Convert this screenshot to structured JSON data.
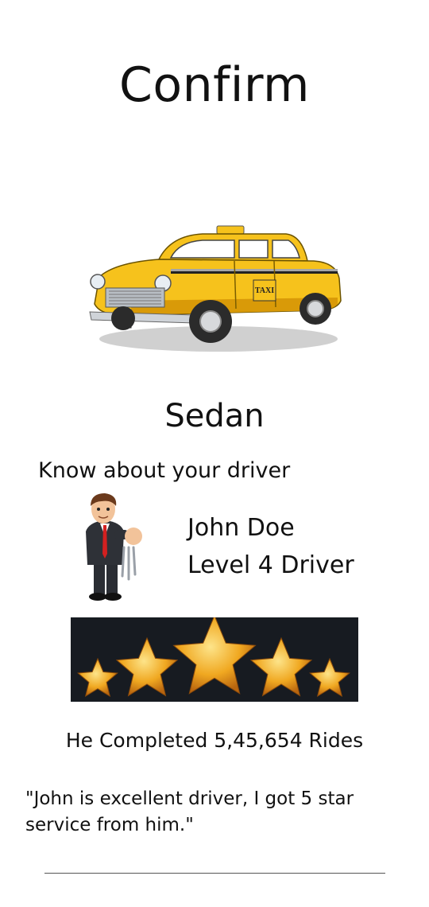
{
  "header": {
    "title": "Confirm"
  },
  "vehicle": {
    "image_icon": "taxi-car-icon",
    "type_label": "Sedan",
    "sign_text": "TAXI",
    "colors": {
      "body": "#f6c21c",
      "body_shade": "#d99a08",
      "tire": "#2b2b2b",
      "chrome": "#cfd3d8"
    }
  },
  "driver": {
    "section_heading": "Know about your driver",
    "avatar_icon": "driver-avatar-icon",
    "name": "John Doe",
    "level": "Level 4 Driver",
    "rating": {
      "stars": 5,
      "max": 5,
      "star_color": "#f0a821"
    },
    "rides_text": "He Completed 5,45,654 Rides",
    "review": "\"John is excellent driver, I got 5 star service from him.\""
  }
}
